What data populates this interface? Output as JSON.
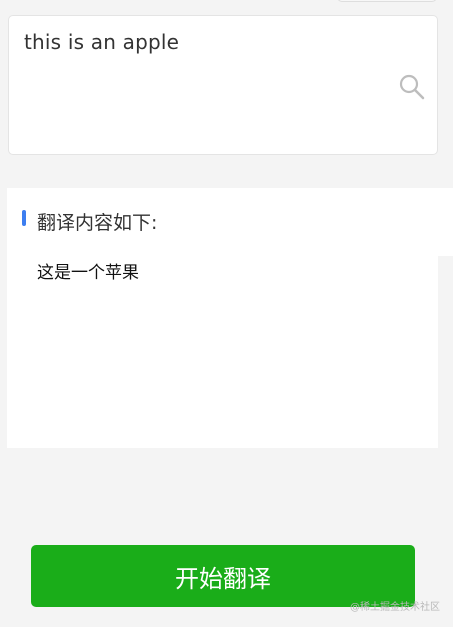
{
  "input": {
    "text": "this is an apple",
    "search_icon": "search-icon"
  },
  "result": {
    "title": "翻译内容如下:",
    "text": "这是一个苹果",
    "accent_color": "#3d7ef0"
  },
  "translate_button": {
    "label": "开始翻译",
    "color": "#1aad19"
  },
  "watermark": {
    "text": "@稀土掘金技术社区"
  }
}
